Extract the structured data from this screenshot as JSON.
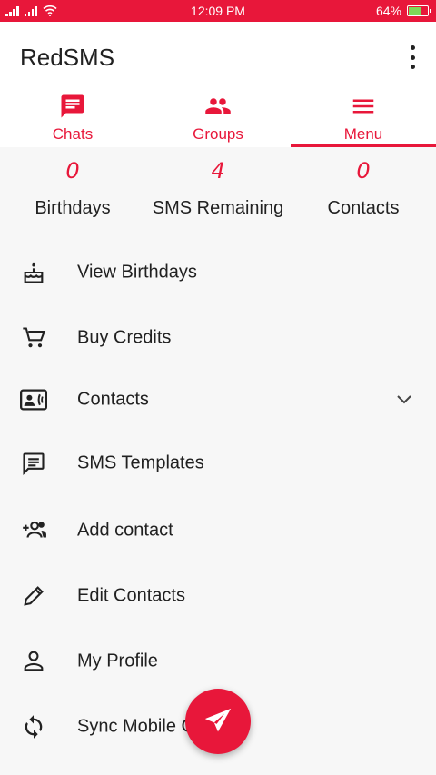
{
  "status_bar": {
    "time": "12:09 PM",
    "battery_text": "64%",
    "battery_level": 0.64,
    "icons": [
      "signal-icon",
      "signal-icon",
      "wifi-icon",
      "battery-icon"
    ]
  },
  "app_bar": {
    "title": "RedSMS",
    "overflow_icon": "more-vertical-icon"
  },
  "tabs": [
    {
      "label": "Chats",
      "icon": "chat-icon",
      "active": false
    },
    {
      "label": "Groups",
      "icon": "group-icon",
      "active": false
    },
    {
      "label": "Menu",
      "icon": "menu-icon",
      "active": true
    }
  ],
  "stats": [
    {
      "value": "0",
      "label": "Birthdays"
    },
    {
      "value": "4",
      "label": "SMS Remaining"
    },
    {
      "value": "0",
      "label": "Contacts"
    }
  ],
  "menu": [
    {
      "label": "View Birthdays",
      "icon": "cake-icon"
    },
    {
      "label": "Buy Credits",
      "icon": "cart-icon"
    },
    {
      "label": "Contacts",
      "icon": "contact-card-icon",
      "expandable": true
    },
    {
      "label": "SMS Templates",
      "icon": "message-icon"
    },
    {
      "label": "Add contact",
      "icon": "add-people-icon"
    },
    {
      "label": "Edit Contacts",
      "icon": "pencil-icon"
    },
    {
      "label": "My Profile",
      "icon": "person-icon"
    },
    {
      "label": "Sync Mobile C",
      "icon": "sync-icon"
    }
  ],
  "fab": {
    "icon": "send-icon"
  },
  "colors": {
    "accent": "#e8173a",
    "battery": "#7ed957",
    "background": "#f7f7f7"
  }
}
